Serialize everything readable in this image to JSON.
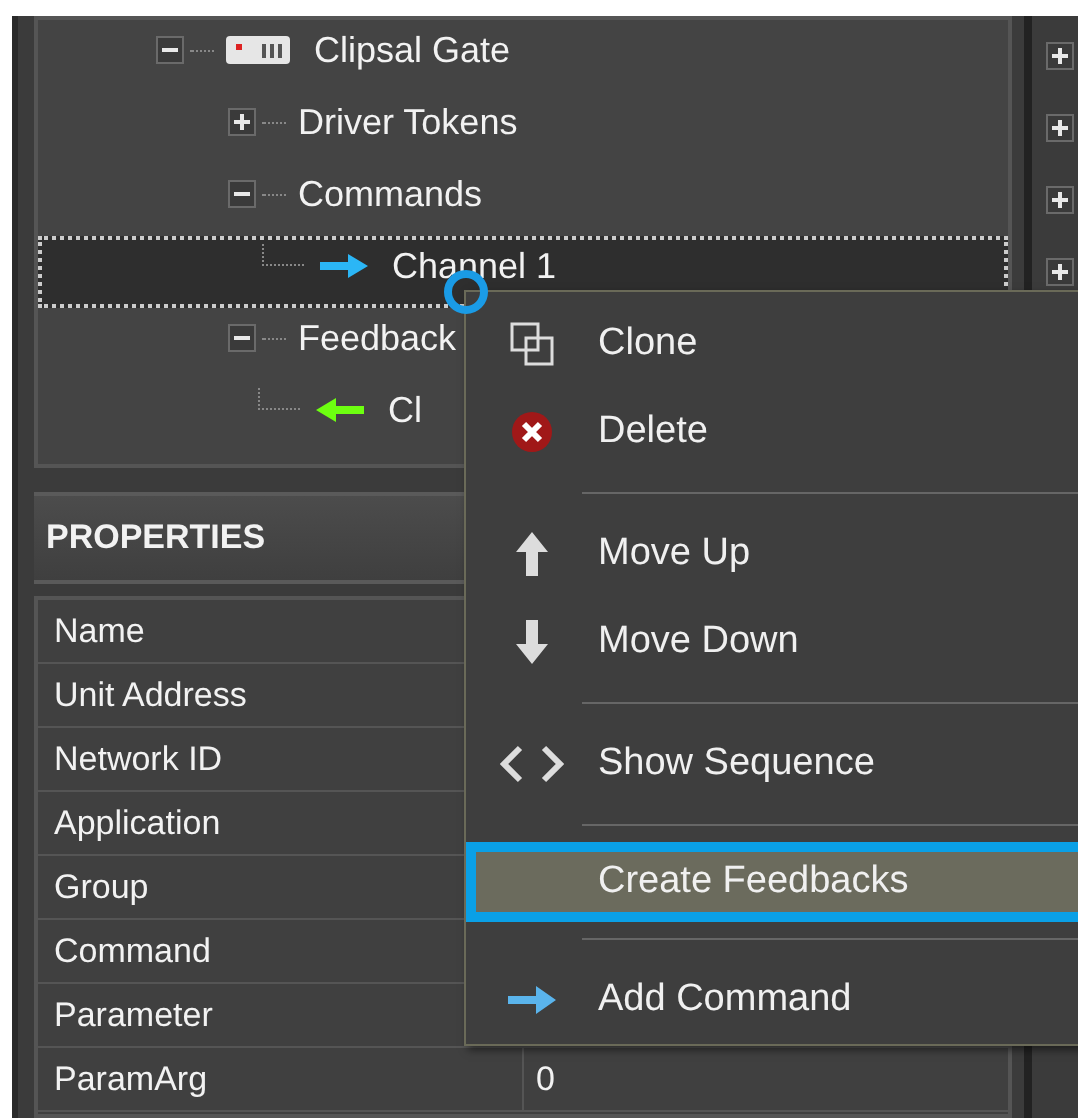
{
  "tree": [
    {
      "label": "Clipsal Gate",
      "kind": "device",
      "expanded": true,
      "selected": false,
      "children": [
        {
          "label": "Driver Tokens",
          "kind": "folder",
          "expanded": false,
          "selected": false
        },
        {
          "label": "Commands",
          "kind": "folder",
          "expanded": true,
          "selected": false,
          "children": [
            {
              "label": "Channel 1",
              "kind": "command",
              "selected": true
            }
          ]
        },
        {
          "label": "Feedback",
          "kind": "folder",
          "expanded": true,
          "selected": false,
          "children": [
            {
              "label": "Cl",
              "kind": "feedback",
              "selected": false
            }
          ]
        }
      ]
    }
  ],
  "side_panel": {
    "items": [
      {
        "expanded": false
      },
      {
        "expanded": false
      },
      {
        "expanded": false
      },
      {
        "expanded": false
      }
    ]
  },
  "properties": {
    "title": "PROPERTIES",
    "rows": [
      {
        "name": "Name"
      },
      {
        "name": "Unit Address"
      },
      {
        "name": "Network ID"
      },
      {
        "name": "Application"
      },
      {
        "name": "Group"
      },
      {
        "name": "Command"
      },
      {
        "name": "Parameter"
      },
      {
        "name": "ParamArg",
        "value": "0"
      }
    ]
  },
  "context_menu": {
    "items": [
      {
        "kind": "item",
        "label": "Clone",
        "selected": false
      },
      {
        "kind": "item",
        "label": "Delete",
        "selected": false
      },
      {
        "kind": "separator"
      },
      {
        "kind": "item",
        "label": "Move Up",
        "selected": false
      },
      {
        "kind": "item",
        "label": "Move Down",
        "selected": false
      },
      {
        "kind": "separator"
      },
      {
        "kind": "item",
        "label": "Show Sequence",
        "selected": false
      },
      {
        "kind": "separator"
      },
      {
        "kind": "item",
        "label": "Create Feedbacks",
        "selected": true
      },
      {
        "kind": "separator"
      },
      {
        "kind": "item",
        "label": "Add Command",
        "selected": false
      }
    ]
  }
}
